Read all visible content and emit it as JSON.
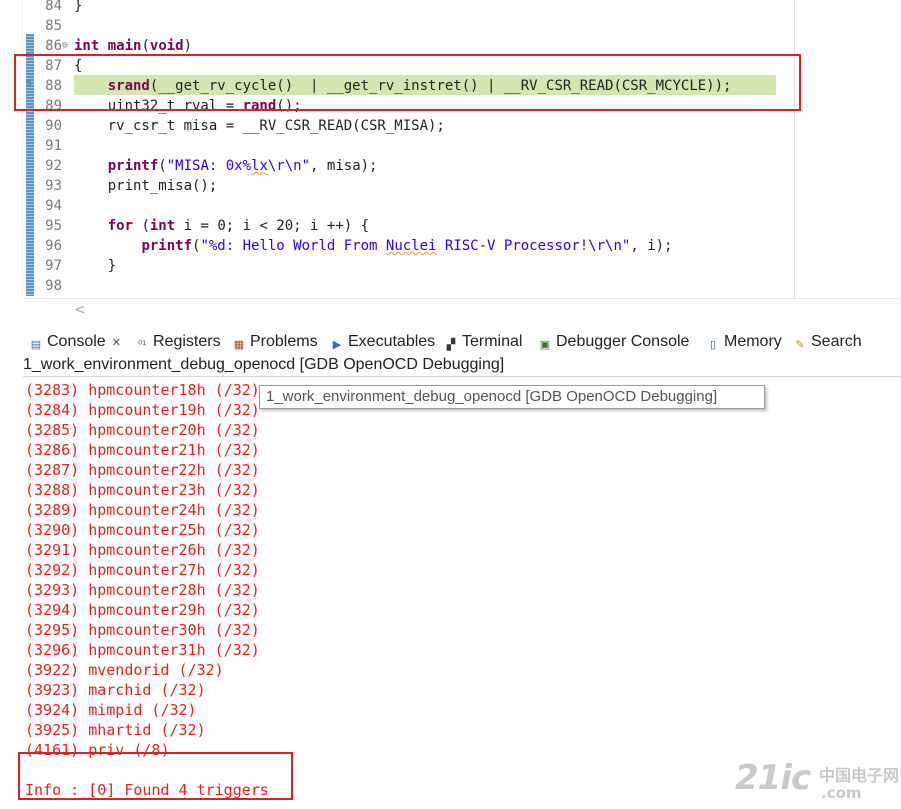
{
  "editor": {
    "lines": [
      {
        "num": "84",
        "segments": [
          {
            "t": "}",
            "c": ""
          }
        ]
      },
      {
        "num": "85",
        "segments": []
      },
      {
        "num": "86",
        "fold": "⊖",
        "segments": [
          {
            "t": "int",
            "c": "kw"
          },
          {
            "t": " ",
            "c": ""
          },
          {
            "t": "main",
            "c": "kw"
          },
          {
            "t": "(",
            "c": ""
          },
          {
            "t": "void",
            "c": "kw"
          },
          {
            "t": ")",
            "c": ""
          }
        ]
      },
      {
        "num": "87",
        "segments": [
          {
            "t": "{",
            "c": ""
          }
        ]
      },
      {
        "num": "88",
        "segments": [
          {
            "t": "    ",
            "c": ""
          },
          {
            "t": "srand",
            "c": "fn"
          },
          {
            "t": "(__get_rv_cycle()  | __get_rv_instret() | __RV_CSR_READ(CSR_MCYCLE));",
            "c": ""
          }
        ]
      },
      {
        "num": "89",
        "segments": [
          {
            "t": "    uint32_t rval = ",
            "c": ""
          },
          {
            "t": "rand",
            "c": "fn"
          },
          {
            "t": "();",
            "c": ""
          }
        ]
      },
      {
        "num": "90",
        "segments": [
          {
            "t": "    rv_csr_t misa = __RV_CSR_READ(CSR_MISA);",
            "c": ""
          }
        ]
      },
      {
        "num": "91",
        "segments": []
      },
      {
        "num": "92",
        "segments": [
          {
            "t": "    ",
            "c": ""
          },
          {
            "t": "printf",
            "c": "fn"
          },
          {
            "t": "(",
            "c": ""
          },
          {
            "t": "\"MISA: 0x%",
            "c": "str"
          },
          {
            "t": "lx",
            "c": "str squig"
          },
          {
            "t": "\\r\\n\"",
            "c": "str"
          },
          {
            "t": ", misa);",
            "c": ""
          }
        ]
      },
      {
        "num": "93",
        "segments": [
          {
            "t": "    print_misa();",
            "c": ""
          }
        ]
      },
      {
        "num": "94",
        "segments": []
      },
      {
        "num": "95",
        "segments": [
          {
            "t": "    ",
            "c": ""
          },
          {
            "t": "for",
            "c": "kw"
          },
          {
            "t": " (",
            "c": ""
          },
          {
            "t": "int",
            "c": "kw"
          },
          {
            "t": " i = 0; i < 20; i ++) {",
            "c": ""
          }
        ]
      },
      {
        "num": "96",
        "segments": [
          {
            "t": "        ",
            "c": ""
          },
          {
            "t": "printf",
            "c": "fn"
          },
          {
            "t": "(",
            "c": ""
          },
          {
            "t": "\"%d: Hello World From ",
            "c": "str"
          },
          {
            "t": "Nuclei",
            "c": "str squig"
          },
          {
            "t": " RISC-V Processor!\\r\\n\"",
            "c": "str"
          },
          {
            "t": ", i);",
            "c": ""
          }
        ]
      },
      {
        "num": "97",
        "segments": [
          {
            "t": "    }",
            "c": ""
          }
        ]
      },
      {
        "num": "98",
        "segments": []
      }
    ],
    "hscroll_left": "<"
  },
  "tabs": [
    {
      "label": "Console",
      "icon": "console-icon",
      "glyph": "▤",
      "color": "#3b6fa8",
      "close": "✕"
    },
    {
      "label": "Registers",
      "icon": "registers-icon",
      "glyph": "⁰¹",
      "color": "#555555"
    },
    {
      "label": "Problems",
      "icon": "problems-icon",
      "glyph": "▦",
      "color": "#b04020"
    },
    {
      "label": "Executables",
      "icon": "executables-icon",
      "glyph": "▶",
      "color": "#2d6cc0"
    },
    {
      "label": "Terminal",
      "icon": "terminal-icon",
      "glyph": "▞",
      "color": "#3a3a3a"
    },
    {
      "label": "Debugger Console",
      "icon": "debugger-console-icon",
      "glyph": "▣",
      "color": "#3a6e2a"
    },
    {
      "label": "Memory",
      "icon": "memory-icon",
      "glyph": "▯",
      "color": "#2d5cb0"
    },
    {
      "label": "Search",
      "icon": "search-icon",
      "glyph": "✎",
      "color": "#c08a20"
    }
  ],
  "console": {
    "title": "1_work_environment_debug_openocd [GDB OpenOCD Debugging]",
    "tooltip": "1_work_environment_debug_openocd [GDB OpenOCD Debugging]",
    "lines": [
      "(3283) hpmcounter18h (/32)",
      "(3284) hpmcounter19h (/32)",
      "(3285) hpmcounter20h (/32)",
      "(3286) hpmcounter21h (/32)",
      "(3287) hpmcounter22h (/32)",
      "(3288) hpmcounter23h (/32)",
      "(3289) hpmcounter24h (/32)",
      "(3290) hpmcounter25h (/32)",
      "(3291) hpmcounter26h (/32)",
      "(3292) hpmcounter27h (/32)",
      "(3293) hpmcounter28h (/32)",
      "(3294) hpmcounter29h (/32)",
      "(3295) hpmcounter30h (/32)",
      "(3296) hpmcounter31h (/32)",
      "(3922) mvendorid (/32)",
      "(3923) marchid (/32)",
      "(3924) mimpid (/32)",
      "(3925) mhartid (/32)",
      "(4161) priv (/8)",
      "",
      "Info : [0] Found 4 triggers"
    ]
  },
  "watermark": {
    "main": "21ic",
    "cn": "中国电子网",
    "com": ".com"
  }
}
